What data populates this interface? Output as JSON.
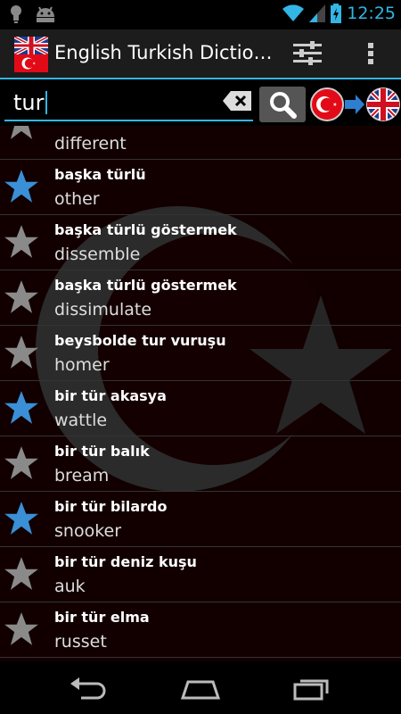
{
  "status_bar": {
    "time": "12:25"
  },
  "action_bar": {
    "title": "English Turkish Dictio…"
  },
  "search": {
    "value": "tur"
  },
  "colors": {
    "accent": "#33b5e5",
    "star_active": "#3a8fd6",
    "star_inactive": "#8a8a8a"
  },
  "list": {
    "partial_top": {
      "english": "different"
    },
    "items": [
      {
        "turkish": "başka türlü",
        "english": "other",
        "starred": true
      },
      {
        "turkish": "başka türlü göstermek",
        "english": "dissemble",
        "starred": false
      },
      {
        "turkish": "başka türlü göstermek",
        "english": "dissimulate",
        "starred": false
      },
      {
        "turkish": "beysbolde tur vuruşu",
        "english": "homer",
        "starred": false
      },
      {
        "turkish": "bir tür akasya",
        "english": "wattle",
        "starred": true
      },
      {
        "turkish": "bir tür balık",
        "english": "bream",
        "starred": false
      },
      {
        "turkish": "bir tür bilardo",
        "english": "snooker",
        "starred": true
      },
      {
        "turkish": "bir tür deniz kuşu",
        "english": "auk",
        "starred": false
      },
      {
        "turkish": "bir tür elma",
        "english": "russet",
        "starred": false
      }
    ]
  }
}
